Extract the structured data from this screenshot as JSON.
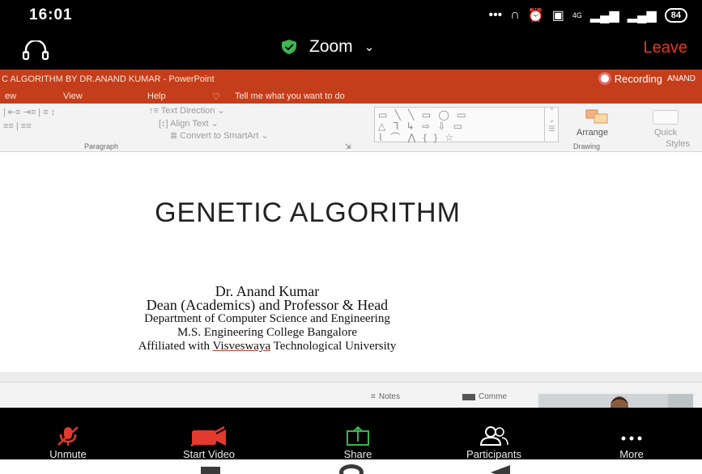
{
  "status_bar": {
    "time": "16:01",
    "signal_tag": "4G",
    "battery": "84",
    "icons": [
      "dots-icon",
      "headset-icon",
      "alarm-icon",
      "volte-icon",
      "signal-icon",
      "signal-icon",
      "battery-icon"
    ]
  },
  "zoom_header": {
    "title": "Zoom",
    "chevron": "⌄",
    "leave_label": "Leave",
    "accent_green": "#3fb54d",
    "leave_color": "#e6371f"
  },
  "powerpoint": {
    "window_title": "C ALGORITHM BY DR.ANAND KUMAR  -  PowerPoint",
    "recording_label": "Recording",
    "user_name": "ANAND",
    "menu": {
      "view_partial": "ew",
      "view": "View",
      "help": "Help",
      "tell_me": "Tell me what you want to do"
    },
    "ribbon": {
      "text_direction": "Text Direction",
      "align_text": "Align Text",
      "convert_smartart": "Convert to SmartArt",
      "paragraph_label": "Paragraph",
      "arrange_label": "Arrange",
      "quick_styles_1": "Quick",
      "quick_styles_2": "Styles",
      "drawing_label": "Drawing",
      "shapes_row1": "▭ ╲ ╲ ▭ ◯ ▭",
      "shapes_row2": "△ ⅂ ↳ ⇨ ⇩ ▭",
      "shapes_row3": "⌇ ⌒ ⋀ { } ☆"
    },
    "slide": {
      "title": "GENETIC ALGORITHM",
      "author": "Dr. Anand Kumar",
      "position": "Dean (Academics) and Professor & Head",
      "department": "Department of Computer Science and Engineering",
      "college": "M.S. Engineering College Bangalore",
      "affiliation_prefix": "Affiliated with ",
      "affiliation_underlined": "Visveswaya",
      "affiliation_suffix": " Technological University"
    },
    "status": {
      "notes": "Notes",
      "comments": "Comme"
    },
    "ribbon_color": "#c43e1c"
  },
  "toolbar": {
    "unmute": "Unmute",
    "start_video": "Start Video",
    "share": "Share",
    "participants": "Participants",
    "more": "More",
    "muted_color": "#e23a2e",
    "share_color": "#3fb54d"
  }
}
